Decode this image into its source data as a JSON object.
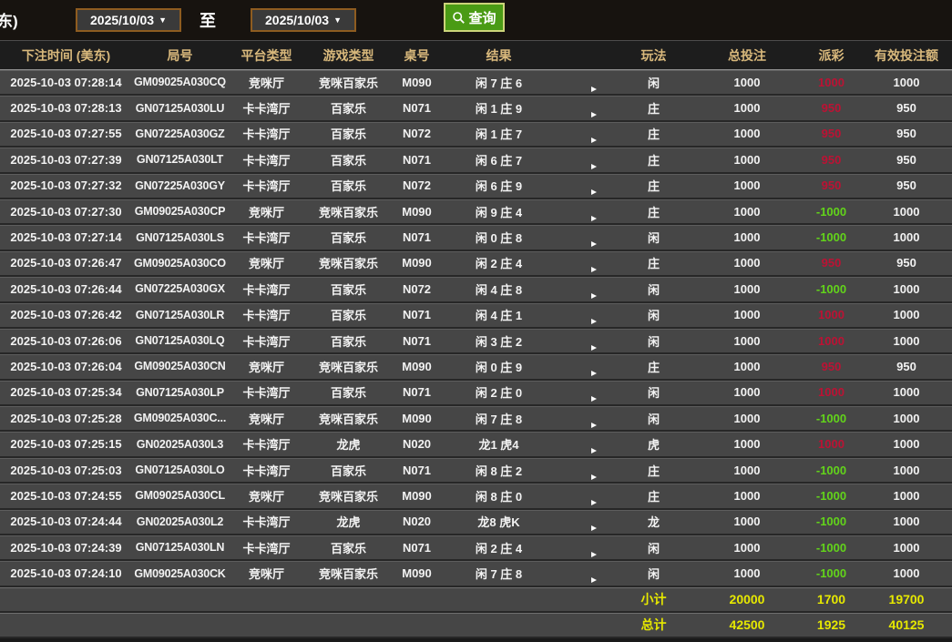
{
  "toolbar": {
    "cutoff_label": "东)",
    "date_from": "2025/10/03",
    "date_to": "2025/10/03",
    "dropdown_arrow": "▼",
    "to_label": "至",
    "search_label": "查询"
  },
  "table": {
    "columns": [
      "下注时间 (美东)",
      "局号",
      "平台类型",
      "游戏类型",
      "桌号",
      "结果",
      "",
      "玩法",
      "总投注",
      "派彩",
      "有效投注额"
    ],
    "rows": [
      {
        "time": "2025-10-03 07:28:14",
        "round": "GM09025A030CQ",
        "platform": "竞咪厅",
        "game": "竞咪百家乐",
        "table_no": "M090",
        "result": "闲 7 庄 6",
        "bet": "闲",
        "total": "1000",
        "payout": "1000",
        "payout_state": "win",
        "valid": "1000"
      },
      {
        "time": "2025-10-03 07:28:13",
        "round": "GN07125A030LU",
        "platform": "卡卡湾厅",
        "game": "百家乐",
        "table_no": "N071",
        "result": "闲 1 庄 9",
        "bet": "庄",
        "total": "1000",
        "payout": "950",
        "payout_state": "win",
        "valid": "950"
      },
      {
        "time": "2025-10-03 07:27:55",
        "round": "GN07225A030GZ",
        "platform": "卡卡湾厅",
        "game": "百家乐",
        "table_no": "N072",
        "result": "闲 1 庄 7",
        "bet": "庄",
        "total": "1000",
        "payout": "950",
        "payout_state": "win",
        "valid": "950"
      },
      {
        "time": "2025-10-03 07:27:39",
        "round": "GN07125A030LT",
        "platform": "卡卡湾厅",
        "game": "百家乐",
        "table_no": "N071",
        "result": "闲 6 庄 7",
        "bet": "庄",
        "total": "1000",
        "payout": "950",
        "payout_state": "win",
        "valid": "950"
      },
      {
        "time": "2025-10-03 07:27:32",
        "round": "GN07225A030GY",
        "platform": "卡卡湾厅",
        "game": "百家乐",
        "table_no": "N072",
        "result": "闲 6 庄 9",
        "bet": "庄",
        "total": "1000",
        "payout": "950",
        "payout_state": "win",
        "valid": "950"
      },
      {
        "time": "2025-10-03 07:27:30",
        "round": "GM09025A030CP",
        "platform": "竞咪厅",
        "game": "竞咪百家乐",
        "table_no": "M090",
        "result": "闲 9 庄 4",
        "bet": "庄",
        "total": "1000",
        "payout": "-1000",
        "payout_state": "loss",
        "valid": "1000"
      },
      {
        "time": "2025-10-03 07:27:14",
        "round": "GN07125A030LS",
        "platform": "卡卡湾厅",
        "game": "百家乐",
        "table_no": "N071",
        "result": "闲 0 庄 8",
        "bet": "闲",
        "total": "1000",
        "payout": "-1000",
        "payout_state": "loss",
        "valid": "1000"
      },
      {
        "time": "2025-10-03 07:26:47",
        "round": "GM09025A030CO",
        "platform": "竞咪厅",
        "game": "竞咪百家乐",
        "table_no": "M090",
        "result": "闲 2 庄 4",
        "bet": "庄",
        "total": "1000",
        "payout": "950",
        "payout_state": "win",
        "valid": "950"
      },
      {
        "time": "2025-10-03 07:26:44",
        "round": "GN07225A030GX",
        "platform": "卡卡湾厅",
        "game": "百家乐",
        "table_no": "N072",
        "result": "闲 4 庄 8",
        "bet": "闲",
        "total": "1000",
        "payout": "-1000",
        "payout_state": "loss",
        "valid": "1000"
      },
      {
        "time": "2025-10-03 07:26:42",
        "round": "GN07125A030LR",
        "platform": "卡卡湾厅",
        "game": "百家乐",
        "table_no": "N071",
        "result": "闲 4 庄 1",
        "bet": "闲",
        "total": "1000",
        "payout": "1000",
        "payout_state": "win",
        "valid": "1000"
      },
      {
        "time": "2025-10-03 07:26:06",
        "round": "GN07125A030LQ",
        "platform": "卡卡湾厅",
        "game": "百家乐",
        "table_no": "N071",
        "result": "闲 3 庄 2",
        "bet": "闲",
        "total": "1000",
        "payout": "1000",
        "payout_state": "win",
        "valid": "1000"
      },
      {
        "time": "2025-10-03 07:26:04",
        "round": "GM09025A030CN",
        "platform": "竞咪厅",
        "game": "竞咪百家乐",
        "table_no": "M090",
        "result": "闲 0 庄 9",
        "bet": "庄",
        "total": "1000",
        "payout": "950",
        "payout_state": "win",
        "valid": "950"
      },
      {
        "time": "2025-10-03 07:25:34",
        "round": "GN07125A030LP",
        "platform": "卡卡湾厅",
        "game": "百家乐",
        "table_no": "N071",
        "result": "闲 2 庄 0",
        "bet": "闲",
        "total": "1000",
        "payout": "1000",
        "payout_state": "win",
        "valid": "1000"
      },
      {
        "time": "2025-10-03 07:25:28",
        "round": "GM09025A030C...",
        "platform": "竞咪厅",
        "game": "竞咪百家乐",
        "table_no": "M090",
        "result": "闲 7 庄 8",
        "bet": "闲",
        "total": "1000",
        "payout": "-1000",
        "payout_state": "loss",
        "valid": "1000"
      },
      {
        "time": "2025-10-03 07:25:15",
        "round": "GN02025A030L3",
        "platform": "卡卡湾厅",
        "game": "龙虎",
        "table_no": "N020",
        "result": "龙1 虎4",
        "bet": "虎",
        "total": "1000",
        "payout": "1000",
        "payout_state": "win",
        "valid": "1000"
      },
      {
        "time": "2025-10-03 07:25:03",
        "round": "GN07125A030LO",
        "platform": "卡卡湾厅",
        "game": "百家乐",
        "table_no": "N071",
        "result": "闲 8 庄 2",
        "bet": "庄",
        "total": "1000",
        "payout": "-1000",
        "payout_state": "loss",
        "valid": "1000"
      },
      {
        "time": "2025-10-03 07:24:55",
        "round": "GM09025A030CL",
        "platform": "竞咪厅",
        "game": "竞咪百家乐",
        "table_no": "M090",
        "result": "闲 8 庄 0",
        "bet": "庄",
        "total": "1000",
        "payout": "-1000",
        "payout_state": "loss",
        "valid": "1000"
      },
      {
        "time": "2025-10-03 07:24:44",
        "round": "GN02025A030L2",
        "platform": "卡卡湾厅",
        "game": "龙虎",
        "table_no": "N020",
        "result": "龙8 虎K",
        "bet": "龙",
        "total": "1000",
        "payout": "-1000",
        "payout_state": "loss",
        "valid": "1000"
      },
      {
        "time": "2025-10-03 07:24:39",
        "round": "GN07125A030LN",
        "platform": "卡卡湾厅",
        "game": "百家乐",
        "table_no": "N071",
        "result": "闲 2 庄 4",
        "bet": "闲",
        "total": "1000",
        "payout": "-1000",
        "payout_state": "loss",
        "valid": "1000"
      },
      {
        "time": "2025-10-03 07:24:10",
        "round": "GM09025A030CK",
        "platform": "竞咪厅",
        "game": "竞咪百家乐",
        "table_no": "M090",
        "result": "闲 7 庄 8",
        "bet": "闲",
        "total": "1000",
        "payout": "-1000",
        "payout_state": "loss",
        "valid": "1000"
      }
    ],
    "summary": [
      {
        "label": "小计",
        "total": "20000",
        "payout": "1700",
        "valid": "19700"
      },
      {
        "label": "总计",
        "total": "42500",
        "payout": "1925",
        "valid": "40125"
      }
    ]
  },
  "icons": {
    "search": "magnifier",
    "play": "play-triangle",
    "dropdown": "▼"
  },
  "colors": {
    "payout_win_red": "#bc1234",
    "payout_loss_green": "#62d41a",
    "summary_yellow": "#e6e800",
    "header_gold": "#d9b97c",
    "button_green": "#4a9b15",
    "button_border": "#ccd47a",
    "datebox_border": "#8e5c20",
    "row_bg": "#464646",
    "toolbar_bg": "#17130f"
  }
}
